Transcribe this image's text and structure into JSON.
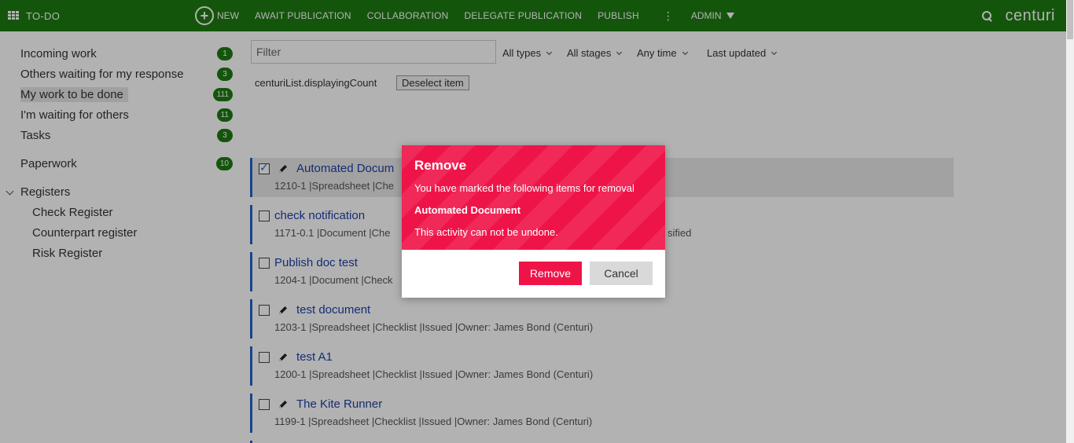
{
  "topbar": {
    "brand": "TO-DO",
    "new_label": "NEW",
    "nav": [
      "AWAIT PUBLICATION",
      "COLLABORATION",
      "DELEGATE PUBLICATION",
      "PUBLISH"
    ],
    "kebab": "⋮",
    "admin": "ADMIN",
    "logo": "centuri"
  },
  "sidebar": {
    "items": [
      {
        "label": "Incoming work",
        "count": "1"
      },
      {
        "label": "Others waiting for my response",
        "count": "3"
      },
      {
        "label": "My work to be done",
        "count": "111"
      },
      {
        "label": "I'm waiting for others",
        "count": "11"
      },
      {
        "label": "Tasks",
        "count": "3"
      },
      {
        "label": "Paperwork",
        "count": "10"
      }
    ],
    "registers": {
      "label": "Registers",
      "items": [
        "Check Register",
        "Counterpart register",
        "Risk Register"
      ]
    }
  },
  "toolbar": {
    "filter_placeholder": "Filter",
    "types": "All types",
    "stages": "All stages",
    "time": "Any time",
    "sort": "Last updated",
    "count_text": "centuriList.displayingCount",
    "deselect": "Deselect item"
  },
  "rows": [
    {
      "title": "Automated Docum",
      "meta": "1210-1 |Spreadsheet |Che"
    },
    {
      "title": "check notification",
      "meta": "1171-0.1 |Document |Che",
      "extra": "sified"
    },
    {
      "title": "Publish doc test",
      "meta": "1204-1 |Document |Check"
    },
    {
      "title": "test document",
      "meta": "1203-1 |Spreadsheet |Checklist |Issued |Owner: James Bond (Centuri)"
    },
    {
      "title": "test A1",
      "meta": "1200-1 |Spreadsheet |Checklist |Issued |Owner: James Bond (Centuri)"
    },
    {
      "title": "The Kite Runner",
      "meta": "1199-1 |Spreadsheet |Checklist |Issued |Owner: James Bond (Centuri)"
    }
  ],
  "modal": {
    "title": "Remove",
    "line1": "You have marked the following items for removal",
    "doc": "Automated Document",
    "line2": "This activity can not be undone.",
    "remove": "Remove",
    "cancel": "Cancel"
  },
  "colors": {
    "brand": "#1d7a12",
    "danger": "#ef1448",
    "link": "#1f3fa8",
    "accent": "#1f66c7"
  }
}
